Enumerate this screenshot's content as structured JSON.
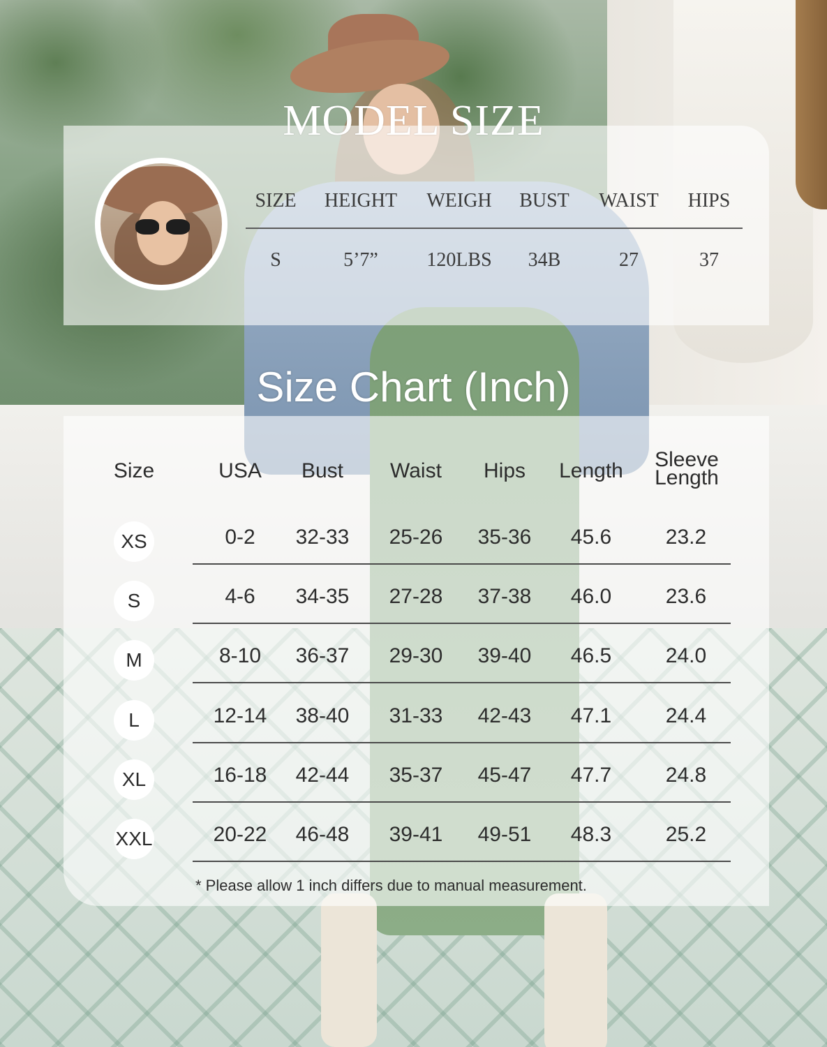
{
  "model_size": {
    "title": "MODEL SIZE",
    "headers": [
      "SIZE",
      "HEIGHT",
      "WEIGH",
      "BUST",
      "WAIST",
      "HIPS"
    ],
    "values": [
      "S",
      "5’7”",
      "120LBS",
      "34B",
      "27",
      "37"
    ]
  },
  "size_chart": {
    "title": "Size Chart (Inch)",
    "headers": [
      "Size",
      "USA",
      "Bust",
      "Waist",
      "Hips",
      "Length"
    ],
    "header_sleeve": [
      "Sleeve",
      "Length"
    ],
    "rows": [
      {
        "size": "XS",
        "cells": [
          "0-2",
          "32-33",
          "25-26",
          "35-36",
          "45.6",
          "23.2"
        ]
      },
      {
        "size": "S",
        "cells": [
          "4-6",
          "34-35",
          "27-28",
          "37-38",
          "46.0",
          "23.6"
        ]
      },
      {
        "size": "M",
        "cells": [
          "8-10",
          "36-37",
          "29-30",
          "39-40",
          "46.5",
          "24.0"
        ]
      },
      {
        "size": "L",
        "cells": [
          "12-14",
          "38-40",
          "31-33",
          "42-43",
          "47.1",
          "24.4"
        ]
      },
      {
        "size": "XL",
        "cells": [
          "16-18",
          "42-44",
          "35-37",
          "45-47",
          "47.7",
          "24.8"
        ]
      },
      {
        "size": "XXL",
        "cells": [
          "20-22",
          "46-48",
          "39-41",
          "49-51",
          "48.3",
          "25.2"
        ]
      }
    ],
    "note": "* Please allow 1 inch differs due to manual measurement."
  }
}
